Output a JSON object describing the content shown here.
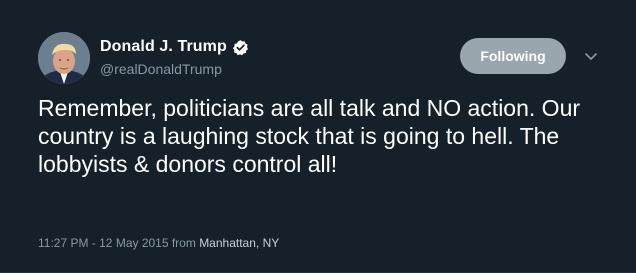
{
  "tweet": {
    "display_name": "Donald J. Trump",
    "handle": "@realDonaldTrump",
    "verified_icon": "verified-badge-icon",
    "follow_label": "Following",
    "more_icon": "chevron-down-icon",
    "text": "Remember, politicians are all talk and NO action. Our country is a laughing stock that is going to hell. The lobbyists & donors control all!",
    "timestamp": "11:27 PM - 12 May 2015 from ",
    "location": "Manhattan, NY"
  },
  "colors": {
    "background": "#15202b",
    "follow_button": "#9aa6ae",
    "secondary_text": "#8899a6",
    "verified": "#ffffff"
  }
}
